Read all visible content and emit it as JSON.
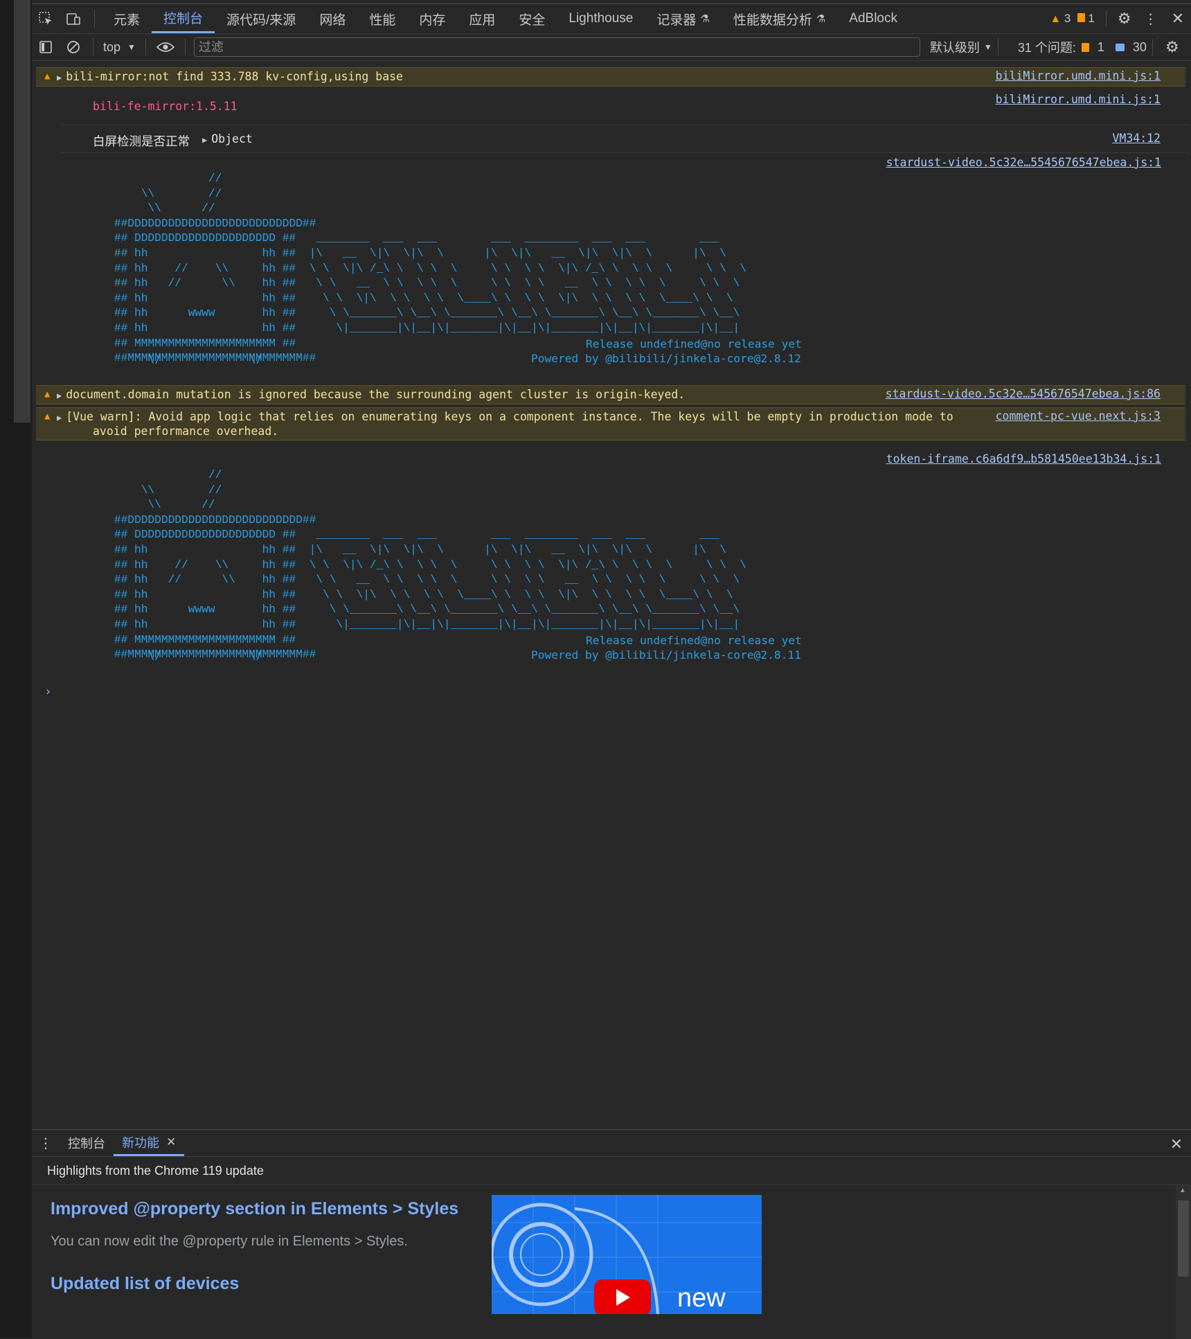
{
  "tabs": [
    "元素",
    "控制台",
    "源代码/来源",
    "网络",
    "性能",
    "内存",
    "应用",
    "安全",
    "Lighthouse",
    "记录器",
    "性能数据分析",
    "AdBlock"
  ],
  "tabbar": {
    "warnings": "3",
    "errors": "1"
  },
  "toolbar": {
    "context": "top",
    "filter_placeholder": "过滤",
    "levels": "默认级别",
    "issues_label": "31 个问题:",
    "issues_error": "1",
    "issues_info": "30"
  },
  "console": {
    "msg1": {
      "text": "bili-mirror:not find 333.788 kv-config,using base",
      "source": "biliMirror.umd.mini.js:1"
    },
    "msg2": {
      "text": "bili-fe-mirror:1.5.11",
      "source": "biliMirror.umd.mini.js:1"
    },
    "msg3": {
      "label": "白屏检测是否正常",
      "object": "Object",
      "source": "VM34:12"
    },
    "art1": {
      "source": "stardust-video.5c32e…5545676547ebea.js:1",
      "release": "Release undefined@no release yet",
      "powered": "Powered by @bilibili/jinkela-core@2.8.12"
    },
    "msg4": {
      "text": "document.domain mutation is ignored because the surrounding agent cluster is origin-keyed.",
      "source": "stardust-video.5c32e…545676547ebea.js:86"
    },
    "msg5": {
      "text": "[Vue warn]: Avoid app logic that relies on enumerating keys on a component instance. The keys will be empty in production mode to",
      "text2": "avoid performance overhead.",
      "source": "comment-pc-vue.next.js:3"
    },
    "art2": {
      "source": "token-iframe.c6a6df9…b581450ee13b34.js:1",
      "release": "Release undefined@no release yet",
      "powered": "Powered by @bilibili/jinkela-core@2.8.11"
    }
  },
  "drawer": {
    "tab_console": "控制台",
    "tab_whatsnew": "新功能",
    "heading": "Highlights from the Chrome 119 update",
    "item1_title": "Improved @property section in Elements > Styles",
    "item1_desc": "You can now edit the @property rule in Elements > Styles.",
    "item2_title": "Updated list of devices",
    "image_text": "new"
  },
  "colors": {
    "accent": "#7cacf8",
    "warning": "#f29900",
    "art": "#2b9de0"
  }
}
